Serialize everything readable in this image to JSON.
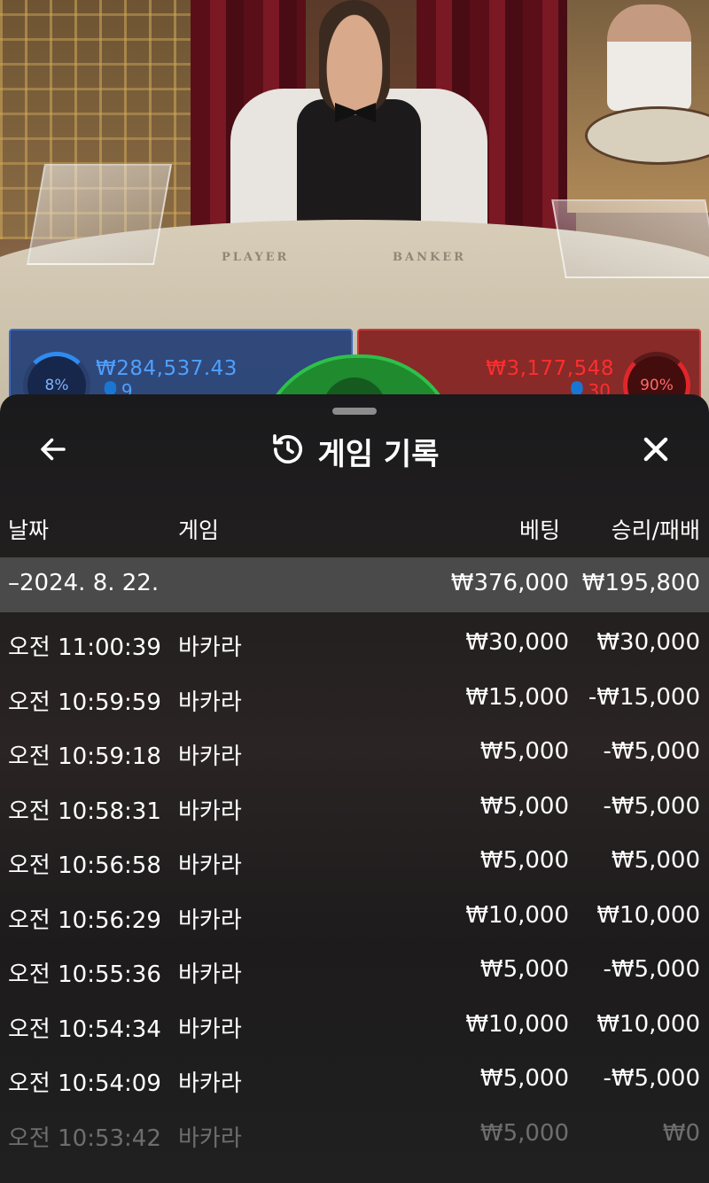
{
  "stream": {
    "table_labels": [
      "PLAYER",
      "BANKER"
    ],
    "player": {
      "percent": "8%",
      "amount": "₩284,537.43",
      "count": "9"
    },
    "banker": {
      "percent": "90%",
      "amount": "₩3,177,548",
      "count": "30"
    }
  },
  "history": {
    "title": "게임 기록",
    "icons": {
      "back": "arrow-left-icon",
      "title": "history-icon",
      "close": "close-icon"
    },
    "columns": {
      "date": "날짜",
      "game": "게임",
      "bet": "베팅",
      "result": "승리/패배"
    },
    "day": {
      "label": "–2024. 8. 22.",
      "bet_total": "₩376,000",
      "result_total": "₩195,800"
    },
    "rows": [
      {
        "time": "오전 11:00:39",
        "game": "바카라",
        "bet": "₩30,000",
        "result": "₩30,000"
      },
      {
        "time": "오전 10:59:59",
        "game": "바카라",
        "bet": "₩15,000",
        "result": "-₩15,000"
      },
      {
        "time": "오전 10:59:18",
        "game": "바카라",
        "bet": "₩5,000",
        "result": "-₩5,000"
      },
      {
        "time": "오전 10:58:31",
        "game": "바카라",
        "bet": "₩5,000",
        "result": "-₩5,000"
      },
      {
        "time": "오전 10:56:58",
        "game": "바카라",
        "bet": "₩5,000",
        "result": "₩5,000"
      },
      {
        "time": "오전 10:56:29",
        "game": "바카라",
        "bet": "₩10,000",
        "result": "₩10,000"
      },
      {
        "time": "오전 10:55:36",
        "game": "바카라",
        "bet": "₩5,000",
        "result": "-₩5,000"
      },
      {
        "time": "오전 10:54:34",
        "game": "바카라",
        "bet": "₩10,000",
        "result": "₩10,000"
      },
      {
        "time": "오전 10:54:09",
        "game": "바카라",
        "bet": "₩5,000",
        "result": "-₩5,000"
      },
      {
        "time": "오전 10:53:42",
        "game": "바카라",
        "bet": "₩5,000",
        "result": "₩0"
      }
    ]
  }
}
